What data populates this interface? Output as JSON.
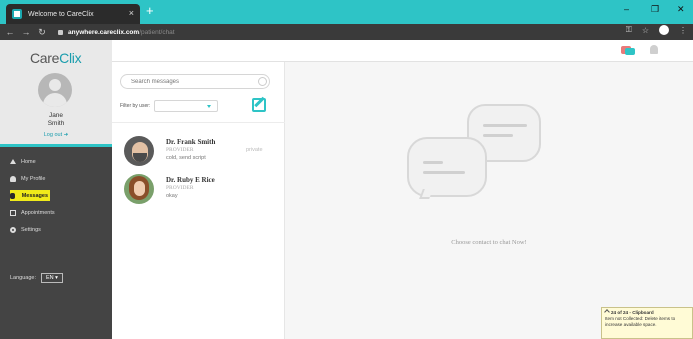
{
  "browser": {
    "tab_title": "Welcome to CareClix",
    "tab_close": "×",
    "new_tab": "+",
    "url_host": "anywhere.careclix.com",
    "url_path": "/patient/chat",
    "window": {
      "minimize": "–",
      "maximize": "❐",
      "close": "✕"
    }
  },
  "brand": {
    "logo_a": "Care",
    "logo_b": "Clix"
  },
  "user": {
    "first": "Jane",
    "last": "Smith",
    "logout": "Log out ➜"
  },
  "nav": [
    {
      "label": "Home",
      "icon": "home-icon"
    },
    {
      "label": "My Profile",
      "icon": "person-icon"
    },
    {
      "label": "Messages",
      "icon": "chat-icon",
      "active": true
    },
    {
      "label": "Appointments",
      "icon": "calendar-icon"
    },
    {
      "label": "Settings",
      "icon": "gear-icon"
    }
  ],
  "language": {
    "label": "Language:",
    "value": "EN ▾"
  },
  "contacts_panel": {
    "search_placeholder": "Search messages",
    "filter_label": "Filter by user:"
  },
  "contacts": [
    {
      "name": "Dr. Frank Smith",
      "role": "PROVIDER",
      "last_message": "cold, send script",
      "tag": "private"
    },
    {
      "name": "Dr. Ruby E Rice",
      "role": "PROVIDER",
      "last_message": "okay",
      "tag": ""
    }
  ],
  "chat": {
    "empty_text": "Choose contact to chat Now!"
  },
  "clipboard": {
    "title": "24 of 24 - Clipboard",
    "message": "Item not Collected: Delete items to increase available space."
  },
  "colors": {
    "accent": "#2ec4c6",
    "highlight": "#f0ea1a",
    "sidebar": "#444444"
  }
}
